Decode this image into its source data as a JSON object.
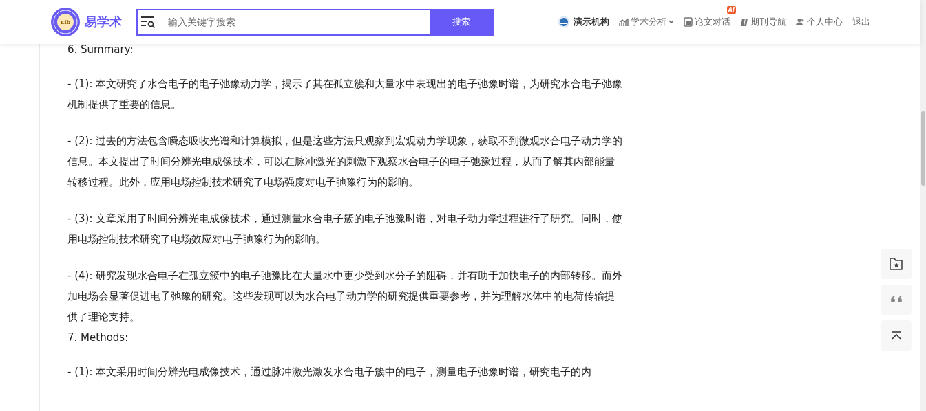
{
  "header": {
    "logo_mark": "Lib",
    "site_name": "易学术",
    "search": {
      "placeholder": "输入关键字搜索",
      "button": "搜索"
    },
    "nav": [
      {
        "kind": "org",
        "label": "演示机构"
      },
      {
        "kind": "analysis",
        "label": "学术分析"
      },
      {
        "kind": "chat",
        "label": "论文对话",
        "badge": "AI"
      },
      {
        "kind": "journals",
        "label": "期刊导航"
      },
      {
        "kind": "profile",
        "label": "个人中心"
      },
      {
        "kind": "logout",
        "label": "退出"
      }
    ]
  },
  "article": {
    "paragraphs": [
      {
        "kind": "heading",
        "text": "6. Summary:"
      },
      {
        "kind": "item",
        "text": "- (1): 本文研究了水合电子的电子弛豫动力学，揭示了其在孤立簇和大量水中表现出的电子弛豫时谱，为研究水合电子弛豫机制提供了重要的信息。"
      },
      {
        "kind": "item",
        "text": "- (2): 过去的方法包含瞬态吸收光谱和计算模拟，但是这些方法只观察到宏观动力学现象，获取不到微观水合电子动力学的信息。本文提出了时间分辨光电成像技术，可以在脉冲激光的刺激下观察水合电子的电子弛豫过程，从而了解其内部能量转移过程。此外，应用电场控制技术研究了电场强度对电子弛豫行为的影响。"
      },
      {
        "kind": "item",
        "text": "- (3): 文章采用了时间分辨光电成像技术，通过测量水合电子簇的电子弛豫时谱，对电子动力学过程进行了研究。同时，使用电场控制技术研究了电场效应对电子弛豫行为的影响。"
      },
      {
        "kind": "item",
        "text": "- (4): 研究发现水合电子在孤立簇中的电子弛豫比在大量水中更少受到水分子的阻碍，并有助于加快电子的内部转移。而外加电场会显著促进电子弛豫的研究。这些发现可以为水合电子动力学的研究提供重要参考，并为理解水体中的电荷传输提供了理论支持。"
      },
      {
        "kind": "heading",
        "text": "7. Methods:"
      },
      {
        "kind": "item",
        "text": "- (1): 本文采用时间分辨光电成像技术，通过脉冲激光激发水合电子簇中的电子，测量电子弛豫时谱，研究电子的内"
      }
    ]
  },
  "tools": [
    {
      "kind": "favorite"
    },
    {
      "kind": "cite"
    },
    {
      "kind": "top"
    }
  ]
}
